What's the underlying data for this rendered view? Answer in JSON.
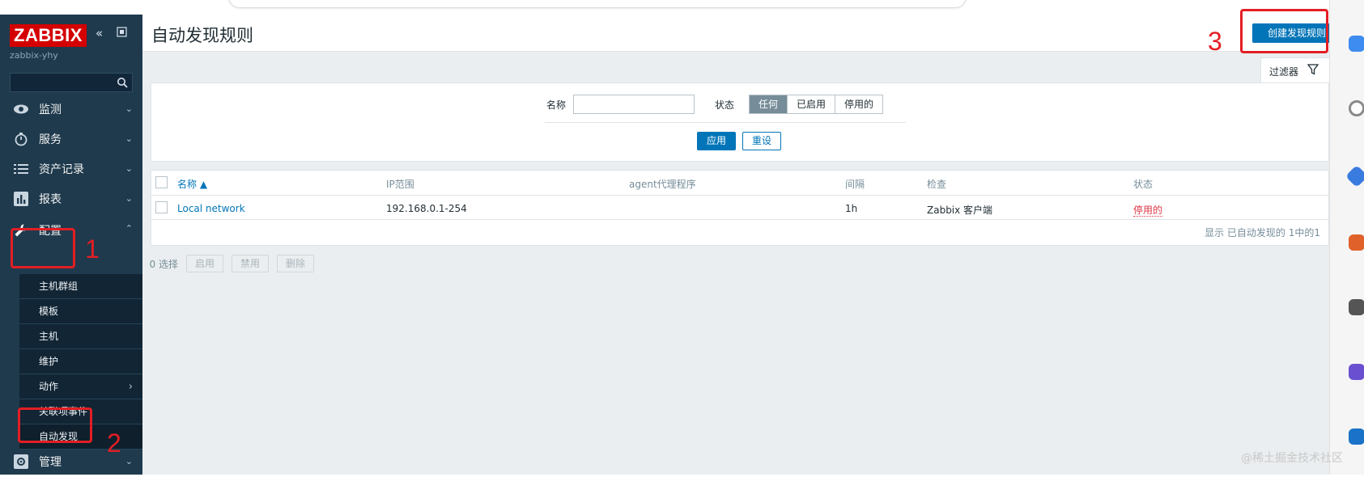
{
  "sidebar": {
    "logo": "ZABBIX",
    "collapse_icon": "double-chevron-left-icon",
    "kiosk_icon": "expand-icon",
    "server_name": "zabbix-yhy",
    "search_placeholder": "",
    "menu": [
      {
        "label": "监测",
        "icon": "eye-icon"
      },
      {
        "label": "服务",
        "icon": "timer-icon"
      },
      {
        "label": "资产记录",
        "icon": "list-icon"
      },
      {
        "label": "报表",
        "icon": "bar-chart-icon"
      },
      {
        "label": "配置",
        "icon": "wrench-icon"
      },
      {
        "label": "管理",
        "icon": "gear-icon"
      }
    ],
    "submenu": [
      {
        "label": "主机群组"
      },
      {
        "label": "模板"
      },
      {
        "label": "主机"
      },
      {
        "label": "维护"
      },
      {
        "label": "动作"
      },
      {
        "label": "关联项事件"
      },
      {
        "label": "自动发现"
      }
    ]
  },
  "header": {
    "title": "自动发现规则",
    "create_button": "创建发现规则"
  },
  "filter": {
    "tab_label": "过滤器",
    "name_label": "名称",
    "name_value": "",
    "status_label": "状态",
    "status_options": [
      "任何",
      "已启用",
      "停用的"
    ],
    "status_selected": "任何",
    "apply": "应用",
    "reset": "重设"
  },
  "table": {
    "columns": [
      "名称 ▲",
      "IP范围",
      "agent代理程序",
      "间隔",
      "检查",
      "状态"
    ],
    "rows": [
      {
        "name": "Local network",
        "ip_range": "192.168.0.1-254",
        "proxy": "",
        "interval": "1h",
        "checks": "Zabbix 客户端",
        "status": "停用的"
      }
    ],
    "footer": "显示 已自动发现的 1中的1"
  },
  "mass_actions": {
    "selected": "0 选择",
    "enable": "启用",
    "disable": "禁用",
    "delete": "删除"
  },
  "annotations": [
    "1",
    "2",
    "3"
  ],
  "watermark": "@稀土掘金技术社区",
  "colors": {
    "sidebar_bg": "#1f3a4d",
    "accent_blue": "#0275b8",
    "logo_red": "#d40000",
    "status_red": "#dc3545",
    "annotation_red": "#e31e24"
  }
}
